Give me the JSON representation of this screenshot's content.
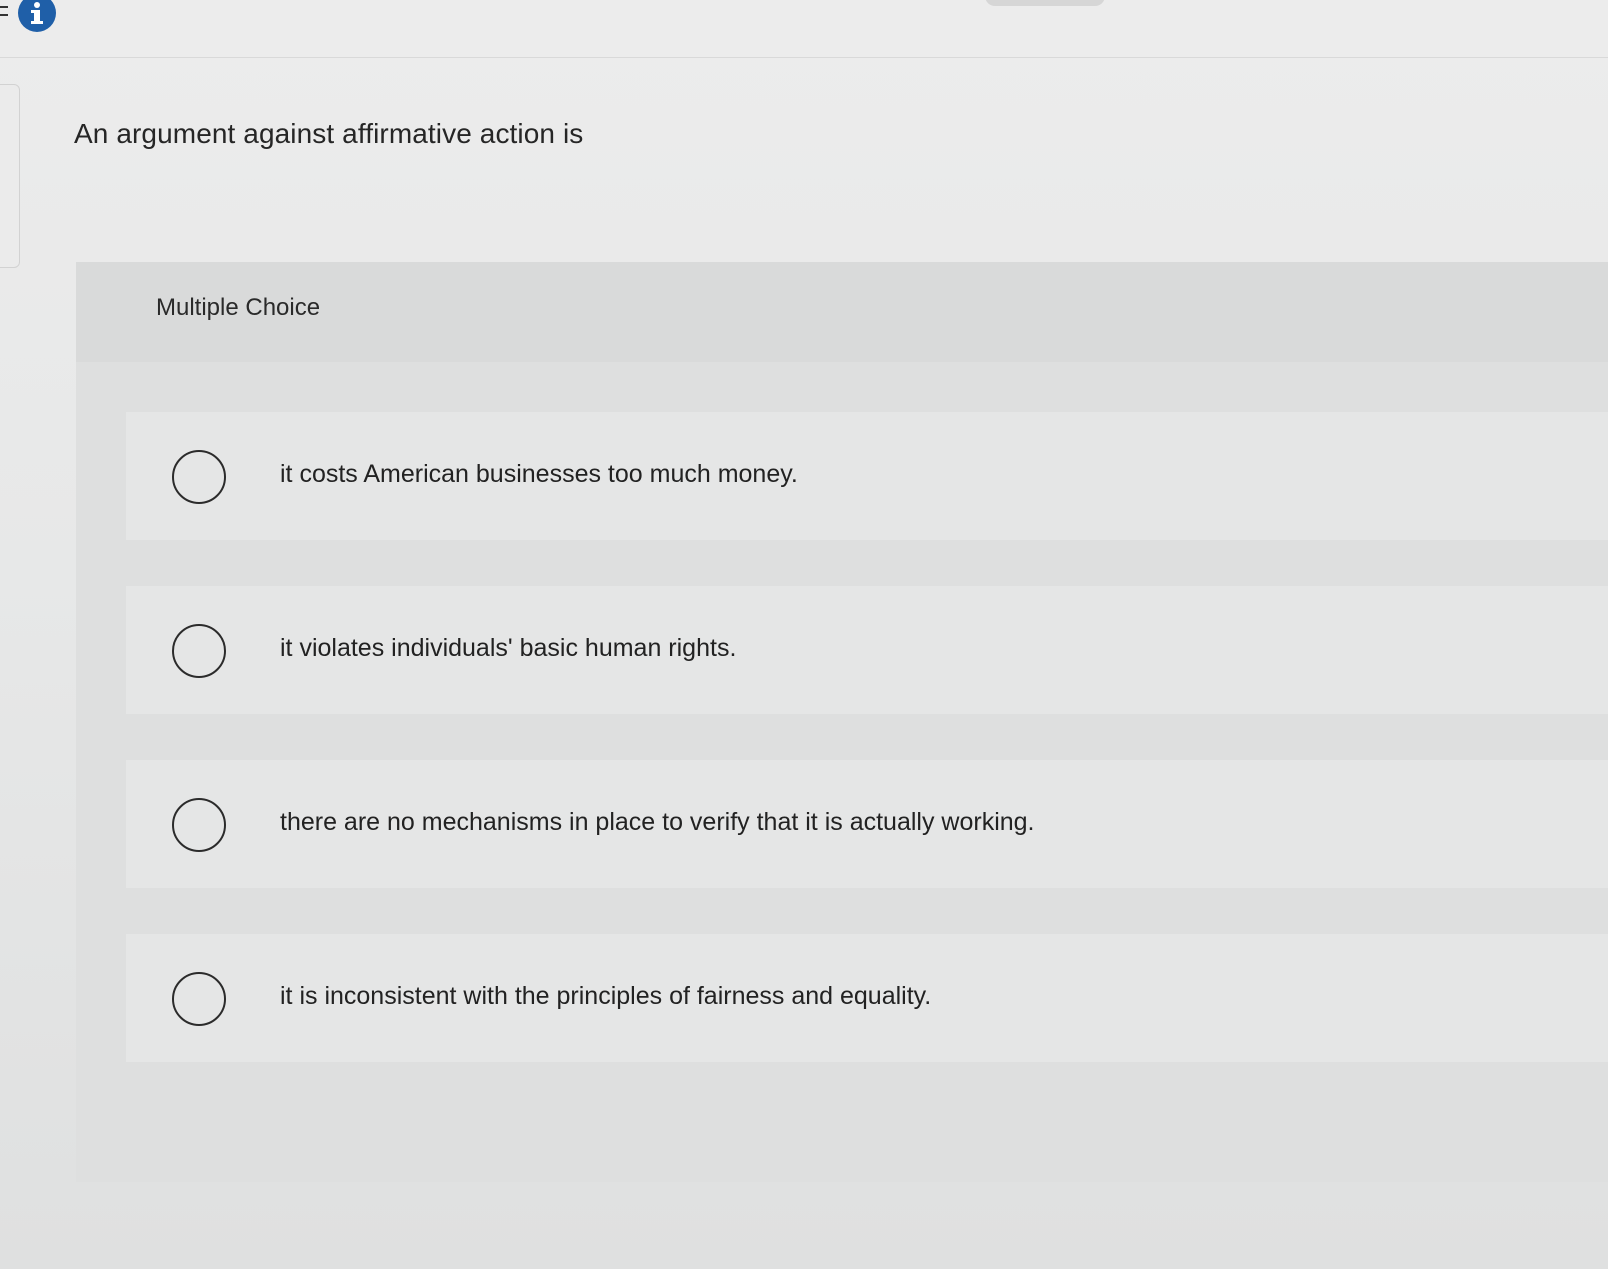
{
  "question": {
    "prompt": "An argument against affirmative action is"
  },
  "answer_area": {
    "type_label": "Multiple Choice",
    "options": [
      {
        "text": "it costs American businesses too much money."
      },
      {
        "text": "it violates individuals' basic human rights."
      },
      {
        "text": "there are no mechanisms in place to verify that it is actually working."
      },
      {
        "text": "it is inconsistent with the principles of fairness and equality."
      }
    ]
  },
  "icons": {
    "info": "info-icon",
    "radio": "radio-circle-icon"
  },
  "colors": {
    "info_icon_bg": "#1f5fa8",
    "text": "#222222",
    "panel_bg": "#dedfdf",
    "option_bg": "#e5e6e6"
  }
}
